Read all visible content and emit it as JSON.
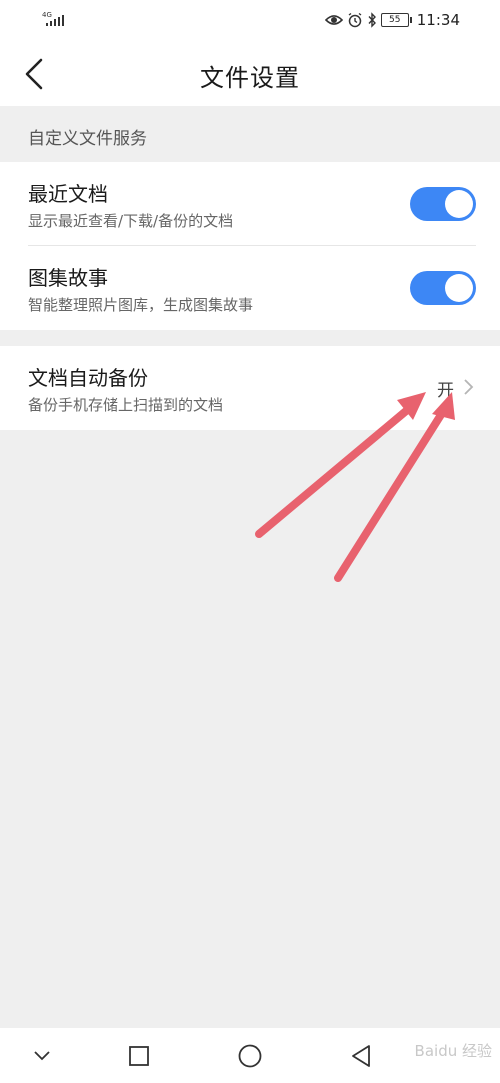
{
  "status_bar": {
    "network": "4G",
    "battery": "55",
    "time": "11:34",
    "icons": [
      "eye-icon",
      "alarm-icon",
      "bluetooth-icon",
      "battery-icon"
    ]
  },
  "header": {
    "title": "文件设置",
    "back_icon": "chevron-left-icon"
  },
  "section": {
    "label": "自定义文件服务"
  },
  "settings": [
    {
      "title": "最近文档",
      "subtitle": "显示最近查看/下载/备份的文档",
      "control": "toggle",
      "enabled": true
    },
    {
      "title": "图集故事",
      "subtitle": "智能整理照片图库，生成图集故事",
      "control": "toggle",
      "enabled": true
    },
    {
      "title": "文档自动备份",
      "subtitle": "备份手机存储上扫描到的文档",
      "control": "link",
      "value": "开"
    }
  ],
  "colors": {
    "toggle_on": "#3d87f5",
    "annotation_arrow": "#e8626e",
    "background": "#efefef"
  },
  "nav_bar": {
    "buttons": [
      "chevron-down-icon",
      "square-icon",
      "circle-icon",
      "triangle-back-icon"
    ]
  },
  "watermark": {
    "text": "Baidu 经验"
  }
}
